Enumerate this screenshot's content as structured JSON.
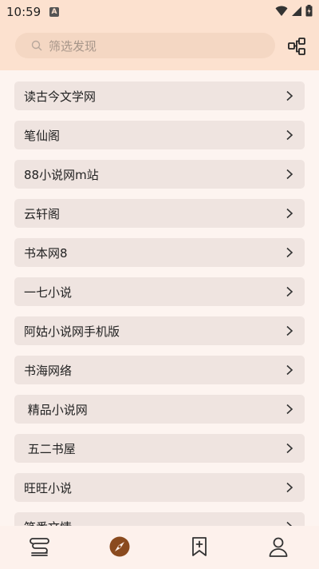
{
  "status_bar": {
    "time": "10:59",
    "notification_letter": "A"
  },
  "search": {
    "placeholder": "筛选发现"
  },
  "sources": [
    {
      "label": "读古今文学网"
    },
    {
      "label": "笔仙阁"
    },
    {
      "label": "88小说网m站"
    },
    {
      "label": "云轩阁"
    },
    {
      "label": "书本网8"
    },
    {
      "label": "一七小说"
    },
    {
      "label": "阿姑小说网手机版"
    },
    {
      "label": "书海网络"
    },
    {
      "label": " 精品小说网"
    },
    {
      "label": " 五二书屋"
    },
    {
      "label": "旺旺小说"
    },
    {
      "label": "笔番文情"
    }
  ],
  "colors": {
    "accent": "#8a4a1e",
    "header_bg": "#fce1cf",
    "item_bg": "#efe4e0"
  },
  "bottom_nav": {
    "items": [
      {
        "icon": "bookshelf-icon"
      },
      {
        "icon": "compass-icon",
        "active": true
      },
      {
        "icon": "bookmark-add-icon"
      },
      {
        "icon": "person-icon"
      }
    ]
  }
}
